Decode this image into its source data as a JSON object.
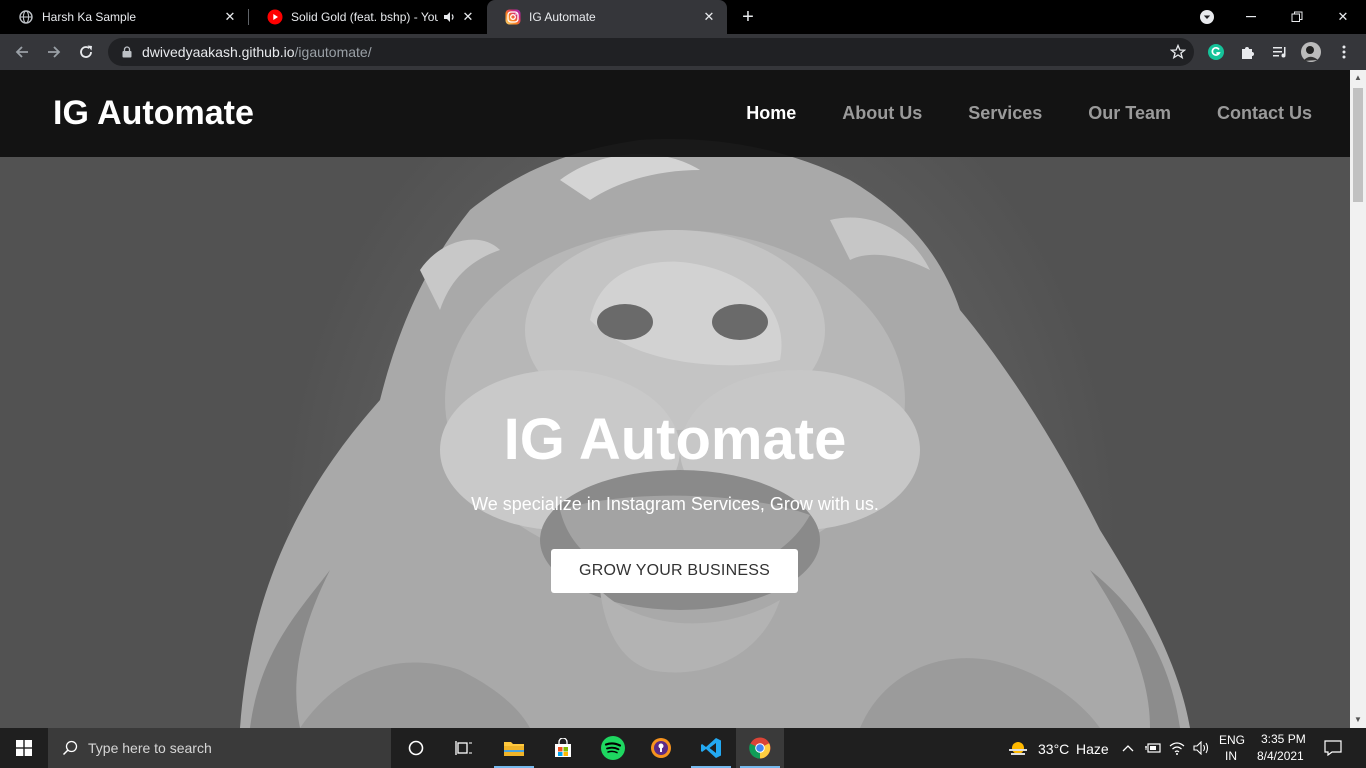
{
  "browser": {
    "tabs": [
      {
        "title": "Harsh Ka Sample",
        "icon": "globe-icon",
        "active": false
      },
      {
        "title": "Solid Gold (feat. bshp) - YouT",
        "icon": "youtube-icon",
        "active": false
      },
      {
        "title": "IG Automate",
        "icon": "instagram-icon",
        "active": true
      }
    ],
    "url_host": "dwivedyaakash.github.io",
    "url_path": "/igautomate/"
  },
  "site": {
    "brand": "IG Automate",
    "nav": [
      "Home",
      "About Us",
      "Services",
      "Our Team",
      "Contact Us"
    ],
    "active_nav": "Home",
    "hero_title": "IG Automate",
    "hero_subtitle": "We specialize in Instagram Services, Grow with us.",
    "cta_label": "GROW YOUR BUSINESS"
  },
  "taskbar": {
    "search_placeholder": "Type here to search",
    "weather_temp": "33°C",
    "weather_desc": "Haze",
    "lang_top": "ENG",
    "lang_bottom": "IN",
    "time": "3:35 PM",
    "date": "8/4/2021"
  },
  "colors": {
    "nav_bg": "#0e0e0e",
    "nav_inactive": "#9a9a9a",
    "accent": "#76b9ed"
  }
}
